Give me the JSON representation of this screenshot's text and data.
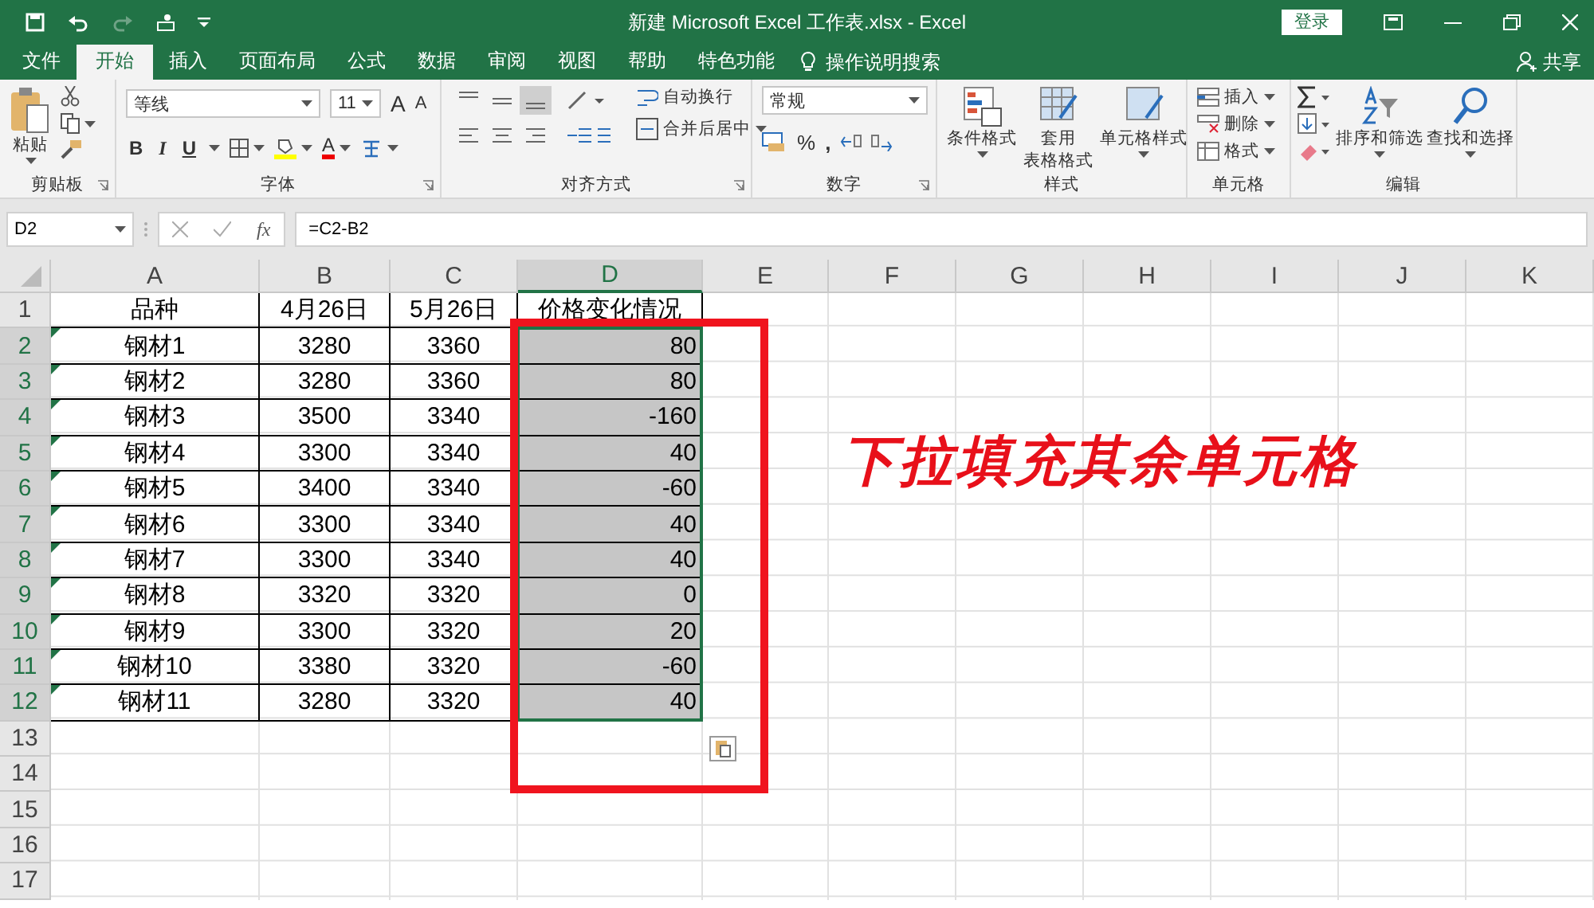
{
  "window": {
    "title": "新建 Microsoft Excel 工作表.xlsx  -  Excel",
    "login_button": "登录"
  },
  "menu_tabs": [
    {
      "label": "文件",
      "selected": false
    },
    {
      "label": "开始",
      "selected": true
    },
    {
      "label": "插入",
      "selected": false
    },
    {
      "label": "页面布局",
      "selected": false
    },
    {
      "label": "公式",
      "selected": false
    },
    {
      "label": "数据",
      "selected": false
    },
    {
      "label": "审阅",
      "selected": false
    },
    {
      "label": "视图",
      "selected": false
    },
    {
      "label": "帮助",
      "selected": false
    },
    {
      "label": "特色功能",
      "selected": false
    }
  ],
  "tell_me": "操作说明搜索",
  "share": "共享",
  "ribbon": {
    "clipboard": {
      "paste": "粘贴",
      "label": "剪贴板"
    },
    "font": {
      "name": "等线",
      "size": "11",
      "grow": "A",
      "shrink": "A",
      "bold": "B",
      "italic": "I",
      "underline": "U",
      "font_color": "A",
      "label": "字体"
    },
    "alignment": {
      "wrap": "自动换行",
      "merge": "合并后居中",
      "label": "对齐方式"
    },
    "number": {
      "format": "常规",
      "percent": "%",
      "comma": ",",
      "label": "数字"
    },
    "styles": {
      "conditional": "条件格式",
      "table_line1": "套用",
      "table_line2": "表格格式",
      "cell_styles": "单元格样式",
      "label": "样式"
    },
    "cells": {
      "insert": "插入",
      "delete": "删除",
      "format": "格式",
      "label": "单元格"
    },
    "editing": {
      "sort": "排序和筛选",
      "find": "查找和选择",
      "label": "编辑"
    }
  },
  "formula_bar": {
    "name_box": "D2",
    "fx": "fx",
    "formula": "=C2-B2"
  },
  "columns": [
    {
      "label": "A",
      "selected": false
    },
    {
      "label": "B",
      "selected": false
    },
    {
      "label": "C",
      "selected": false
    },
    {
      "label": "D",
      "selected": true
    },
    {
      "label": "E",
      "selected": false
    },
    {
      "label": "F",
      "selected": false
    },
    {
      "label": "G",
      "selected": false
    },
    {
      "label": "H",
      "selected": false
    },
    {
      "label": "I",
      "selected": false
    },
    {
      "label": "J",
      "selected": false
    },
    {
      "label": "K",
      "selected": false
    }
  ],
  "rows": [
    {
      "number": "1",
      "selected": false,
      "flag": false,
      "cells": [
        "品种",
        "4月26日",
        "5月26日",
        "价格变化情况"
      ]
    },
    {
      "number": "2",
      "selected": true,
      "flag": true,
      "cells": [
        "钢材1",
        "3280",
        "3360",
        "80"
      ]
    },
    {
      "number": "3",
      "selected": true,
      "flag": true,
      "cells": [
        "钢材2",
        "3280",
        "3360",
        "80"
      ]
    },
    {
      "number": "4",
      "selected": true,
      "flag": true,
      "cells": [
        "钢材3",
        "3500",
        "3340",
        "-160"
      ]
    },
    {
      "number": "5",
      "selected": true,
      "flag": true,
      "cells": [
        "钢材4",
        "3300",
        "3340",
        "40"
      ]
    },
    {
      "number": "6",
      "selected": true,
      "flag": true,
      "cells": [
        "钢材5",
        "3400",
        "3340",
        "-60"
      ]
    },
    {
      "number": "7",
      "selected": true,
      "flag": true,
      "cells": [
        "钢材6",
        "3300",
        "3340",
        "40"
      ]
    },
    {
      "number": "8",
      "selected": true,
      "flag": true,
      "cells": [
        "钢材7",
        "3300",
        "3340",
        "40"
      ]
    },
    {
      "number": "9",
      "selected": true,
      "flag": true,
      "cells": [
        "钢材8",
        "3320",
        "3320",
        "0"
      ]
    },
    {
      "number": "10",
      "selected": true,
      "flag": true,
      "cells": [
        "钢材9",
        "3300",
        "3320",
        "20"
      ]
    },
    {
      "number": "11",
      "selected": true,
      "flag": true,
      "cells": [
        "钢材10",
        "3380",
        "3320",
        "-60"
      ]
    },
    {
      "number": "12",
      "selected": true,
      "flag": true,
      "cells": [
        "钢材11",
        "3280",
        "3320",
        "40"
      ]
    },
    {
      "number": "13",
      "selected": false
    },
    {
      "number": "14",
      "selected": false
    },
    {
      "number": "15",
      "selected": false
    },
    {
      "number": "16",
      "selected": false
    },
    {
      "number": "17",
      "selected": false
    }
  ],
  "annotation": {
    "text": "下拉填充其余单元格"
  }
}
